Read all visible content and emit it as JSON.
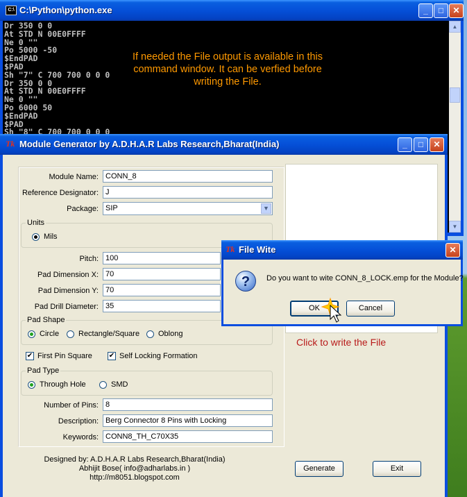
{
  "console": {
    "title": "C:\\Python\\python.exe",
    "lines": [
      "Dr 350 0 0",
      "At STD N 00E0FFFF",
      "Ne 0 \"\"",
      "Po 5000 -50",
      "$EndPAD",
      "$PAD",
      "Sh \"7\" C 700 700 0 0 0",
      "Dr 350 0 0",
      "At STD N 00E0FFFF",
      "Ne 0 \"\"",
      "Po 6000 50",
      "$EndPAD",
      "$PAD",
      "Sh \"8\" C 700 700 0 0 0"
    ],
    "note": "If needed the File output is available in this command window. It can be verfied before writing the File."
  },
  "module_generator": {
    "title": "Module Generator by A.D.H.A.R Labs Research,Bharat(India)",
    "fields": {
      "module_name": {
        "label": "Module Name:",
        "value": "CONN_8"
      },
      "ref_designator": {
        "label": "Reference Designator:",
        "value": "J"
      },
      "package": {
        "label": "Package:",
        "value": "SIP"
      },
      "pitch": {
        "label": "Pitch:",
        "value": "100"
      },
      "pad_dim_x": {
        "label": "Pad Dimension X:",
        "value": "70"
      },
      "pad_dim_y": {
        "label": "Pad Dimension Y:",
        "value": "70"
      },
      "pad_drill": {
        "label": "Pad Drill Diameter:",
        "value": "35"
      },
      "num_pins": {
        "label": "Number of Pins:",
        "value": "8"
      },
      "description": {
        "label": "Description:",
        "value": "Berg Connector 8 Pins with Locking"
      },
      "keywords": {
        "label": "Keywords:",
        "value": "CONN8_TH_C70X35"
      }
    },
    "units": {
      "title": "Units",
      "option": "Mils"
    },
    "pad_shape": {
      "title": "Pad Shape",
      "options": [
        "Circle",
        "Rectangle/Square",
        "Oblong"
      ],
      "selected": "Circle"
    },
    "checks": {
      "first_pin_square": "First Pin Square",
      "self_locking": "Self Locking Formation"
    },
    "pad_type": {
      "title": "Pad Type",
      "options": [
        "Through Hole",
        "SMD"
      ],
      "selected": "Through Hole"
    },
    "credits": [
      "Designed by: A.D.H.A.R Labs Research,Bharat(India)",
      "Abhijit Bose( info@adharlabs.in )",
      "http://m8051.blogspot.com"
    ],
    "generate_label": "Generate",
    "exit_label": "Exit",
    "hint": "Click to write the File"
  },
  "dialog": {
    "title": "File Wite",
    "message": "Do you want to wite CONN_8_LOCK.emp for the Module?",
    "ok_label": "OK",
    "cancel_label": "Cancel"
  },
  "colors": {
    "xp_blue": "#0550d8",
    "note_orange": "#ff9900",
    "hint_red": "#b81a1a",
    "face": "#ece9d8"
  }
}
